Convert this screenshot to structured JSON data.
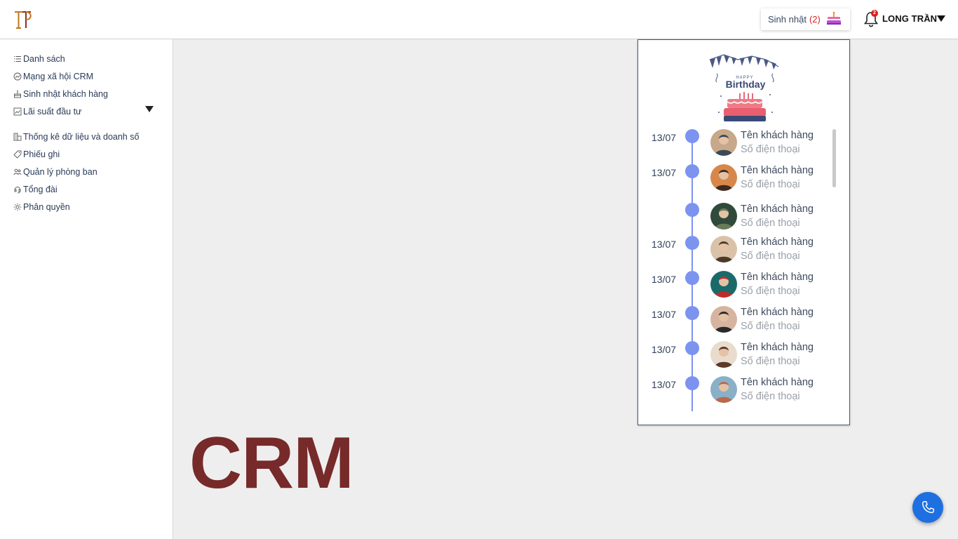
{
  "header": {
    "birthday_label": "Sinh nhật",
    "birthday_count": "(2)",
    "notification_count": "2",
    "user_name": "LONG TRẦN"
  },
  "sidebar": {
    "items": [
      {
        "label": "Danh sách",
        "icon": "list-icon"
      },
      {
        "label": "Mạng xã hội CRM",
        "icon": "chart-icon"
      },
      {
        "label": "Sinh nhật khách hàng",
        "icon": "cake-icon"
      },
      {
        "label": "Lãi suất đầu tư",
        "icon": "chart-box-icon"
      },
      {
        "label": "Thống kê dữ liệu và doanh số",
        "icon": "building-icon"
      },
      {
        "label": "Phiếu ghi",
        "icon": "tag-icon"
      },
      {
        "label": "Quản lý phòng ban",
        "icon": "users-icon"
      },
      {
        "label": "Tổng đài",
        "icon": "headset-icon"
      },
      {
        "label": "Phân quyền",
        "icon": "gear-icon"
      }
    ]
  },
  "main": {
    "title": "CRM"
  },
  "birthday_panel": {
    "banner_small": "HAPPY",
    "banner_text": "Birthday",
    "entries": [
      {
        "date": "13/07",
        "name": "Tên khách hàng",
        "phone": "Số điện thoại"
      },
      {
        "date": "13/07",
        "name": "Tên khách hàng",
        "phone": "Số điện thoại"
      },
      {
        "date": "",
        "name": "Tên khách hàng",
        "phone": "Số điện thoại"
      },
      {
        "date": "13/07",
        "name": "Tên khách hàng",
        "phone": "Số điện thoại"
      },
      {
        "date": "13/07",
        "name": "Tên khách hàng",
        "phone": "Số điện thoại"
      },
      {
        "date": "13/07",
        "name": "Tên khách hàng",
        "phone": "Số điện thoại"
      },
      {
        "date": "13/07",
        "name": "Tên khách hàng",
        "phone": "Số điện thoại"
      },
      {
        "date": "13/07",
        "name": "Tên khách hàng",
        "phone": "Số điện thoại"
      }
    ]
  },
  "colors": {
    "brand": "#762a2a",
    "timeline": "#7c93f0",
    "call_button": "#1e6fe0"
  }
}
